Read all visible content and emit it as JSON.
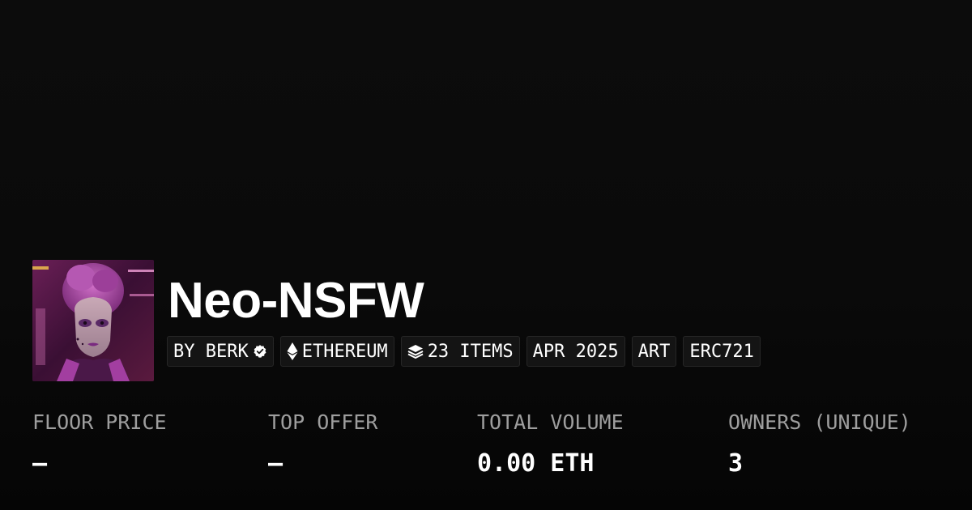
{
  "collection": {
    "name": "Neo-NSFW"
  },
  "tags": {
    "creator": "BY BERK",
    "chain": "ETHEREUM",
    "items": "23 ITEMS",
    "date": "APR 2025",
    "category": "ART",
    "standard": "ERC721"
  },
  "stats": {
    "floor_price": {
      "label": "FLOOR PRICE",
      "value": "–"
    },
    "top_offer": {
      "label": "TOP OFFER",
      "value": "–"
    },
    "total_volume": {
      "label": "TOTAL VOLUME",
      "value": "0.00 ETH"
    },
    "owners": {
      "label": "OWNERS (UNIQUE)",
      "value": "3"
    }
  },
  "icons": {
    "verified": "verified-badge-icon",
    "chain": "ethereum-icon",
    "items": "layers-icon"
  },
  "colors": {
    "background": "#0b0b0b",
    "tag_background": "#141414",
    "label": "#9e9e9e",
    "text": "#ffffff"
  }
}
